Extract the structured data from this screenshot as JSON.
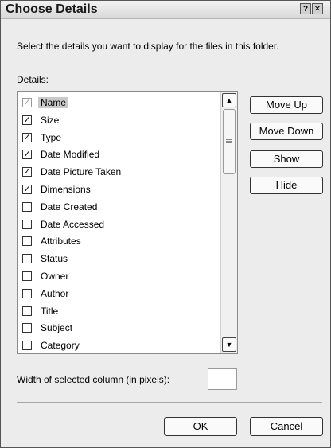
{
  "dialog": {
    "title": "Choose Details",
    "help_glyph": "?",
    "close_glyph": "✕",
    "instruction": "Select the details you want to display for the files in this folder.",
    "details_label": "Details:",
    "width_label": "Width of selected column (in pixels):",
    "width_value": ""
  },
  "details": [
    {
      "label": "Name",
      "checked": true,
      "disabled": true,
      "selected": true
    },
    {
      "label": "Size",
      "checked": true
    },
    {
      "label": "Type",
      "checked": true
    },
    {
      "label": "Date Modified",
      "checked": true
    },
    {
      "label": "Date Picture Taken",
      "checked": true
    },
    {
      "label": "Dimensions",
      "checked": true
    },
    {
      "label": "Date Created",
      "checked": false
    },
    {
      "label": "Date Accessed",
      "checked": false
    },
    {
      "label": "Attributes",
      "checked": false
    },
    {
      "label": "Status",
      "checked": false
    },
    {
      "label": "Owner",
      "checked": false
    },
    {
      "label": "Author",
      "checked": false
    },
    {
      "label": "Title",
      "checked": false
    },
    {
      "label": "Subject",
      "checked": false
    },
    {
      "label": "Category",
      "checked": false
    },
    {
      "label": "",
      "checked": false
    }
  ],
  "buttons": {
    "move_up": "Move Up",
    "move_down": "Move Down",
    "show": "Show",
    "hide": "Hide",
    "ok": "OK",
    "cancel": "Cancel"
  },
  "scrollbar": {
    "up_glyph": "▲",
    "down_glyph": "▼"
  }
}
